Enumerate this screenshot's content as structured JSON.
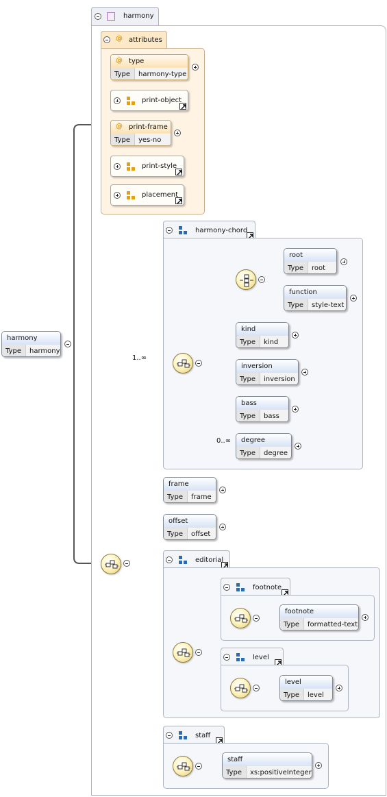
{
  "root_group": {
    "name": "harmony"
  },
  "root_element": {
    "name": "harmony",
    "type_label": "Type",
    "type": "harmony"
  },
  "attributes": {
    "label": "attributes",
    "type": {
      "name": "type",
      "type_label": "Type",
      "type": "harmony-type"
    },
    "print_object": {
      "name": "print-object"
    },
    "print_frame": {
      "name": "print-frame",
      "type_label": "Type",
      "type": "yes-no"
    },
    "print_style": {
      "name": "print-style"
    },
    "placement": {
      "name": "placement"
    }
  },
  "harmony_chord": {
    "label": "harmony-chord",
    "occurrence": "1..∞",
    "root": {
      "name": "root",
      "type_label": "Type",
      "type": "root"
    },
    "function": {
      "name": "function",
      "type_label": "Type",
      "type": "style-text"
    },
    "kind": {
      "name": "kind",
      "type_label": "Type",
      "type": "kind"
    },
    "inversion": {
      "name": "inversion",
      "type_label": "Type",
      "type": "inversion"
    },
    "bass": {
      "name": "bass",
      "type_label": "Type",
      "type": "bass"
    },
    "degree": {
      "name": "degree",
      "type_label": "Type",
      "type": "degree",
      "occurrence": "0..∞"
    }
  },
  "frame": {
    "name": "frame",
    "type_label": "Type",
    "type": "frame"
  },
  "offset": {
    "name": "offset",
    "type_label": "Type",
    "type": "offset"
  },
  "editorial": {
    "label": "editorial",
    "footnote_group": {
      "label": "footnote"
    },
    "footnote": {
      "name": "footnote",
      "type_label": "Type",
      "type": "formatted-text"
    },
    "level_group": {
      "label": "level"
    },
    "level": {
      "name": "level",
      "type_label": "Type",
      "type": "level"
    }
  },
  "staff_group": {
    "label": "staff"
  },
  "staff": {
    "name": "staff",
    "type_label": "Type",
    "type": "xs:positiveInteger"
  }
}
